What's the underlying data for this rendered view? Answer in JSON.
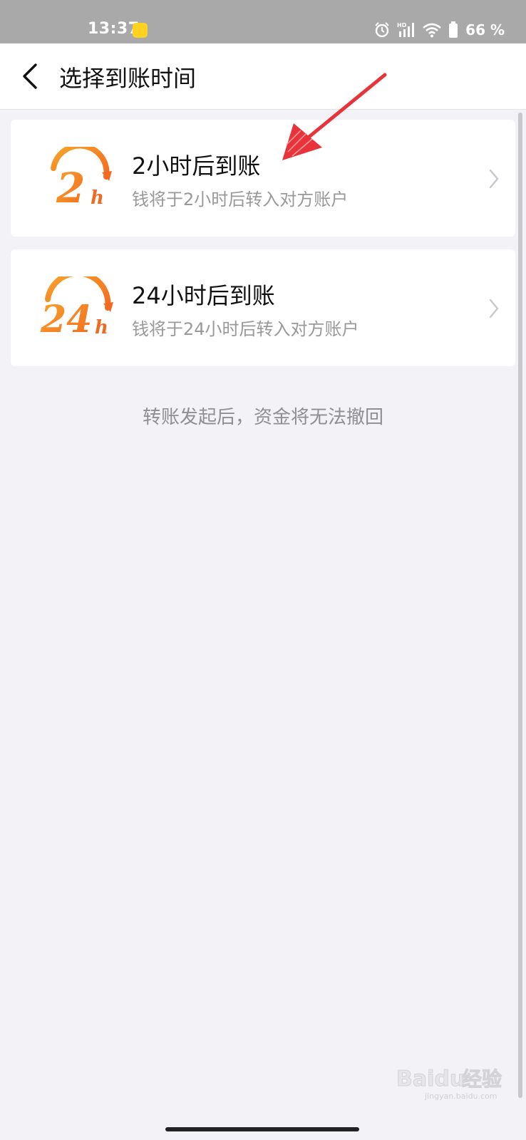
{
  "status_bar": {
    "time": "13:37",
    "battery": "66 %",
    "icons": [
      "app-notification-icon",
      "alarm-icon",
      "hd-signal-icon",
      "wifi-icon",
      "battery-icon"
    ]
  },
  "nav": {
    "title": "选择到账时间",
    "back_icon": "chevron-left-icon"
  },
  "options": [
    {
      "icon_text": "2",
      "icon_unit": "h",
      "title": "2小时后到账",
      "subtitle": "钱将于2小时后转入对方账户"
    },
    {
      "icon_text": "24",
      "icon_unit": "h",
      "title": "24小时后到账",
      "subtitle": "钱将于24小时后转入对方账户"
    }
  ],
  "hint": "转账发起后，资金将无法撤回",
  "watermark": {
    "brand": "Baidu",
    "suffix": "经验",
    "url": "jingyan.baidu.com"
  },
  "colors": {
    "accent_orange": "#f26a21",
    "accent_yellow": "#f8a52a",
    "annotation_red": "#e8333a",
    "background": "#f2f2f7"
  }
}
